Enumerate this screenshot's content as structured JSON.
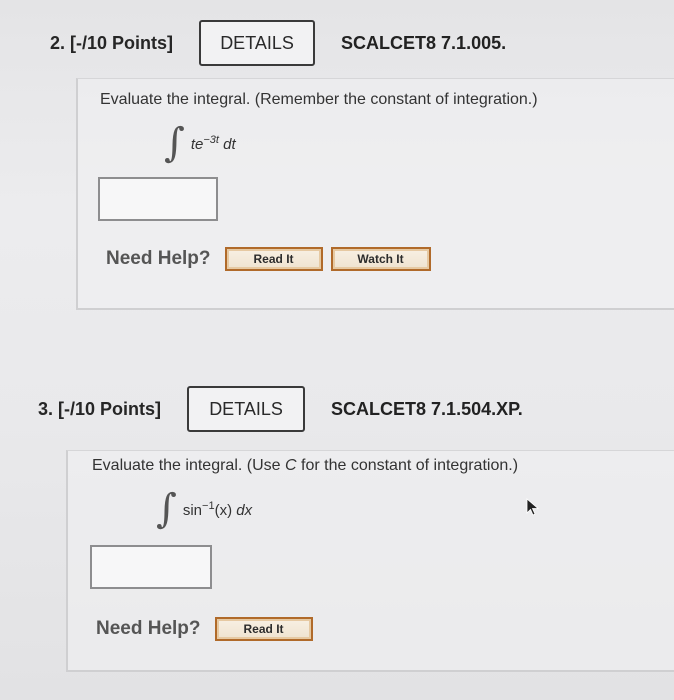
{
  "q2": {
    "number": "2. [-/10 Points]",
    "details_label": "DETAILS",
    "code": "SCALCET8 7.1.005.",
    "prompt": "Evaluate the integral. (Remember the constant of integration.)",
    "integrand_base": "te",
    "integrand_exp": "−3t",
    "differential": "dt",
    "answer_value": "",
    "need_help": "Need Help?",
    "read_it": "Read It",
    "watch_it": "Watch It"
  },
  "q3": {
    "number": "3. [-/10 Points]",
    "details_label": "DETAILS",
    "code": "SCALCET8 7.1.504.XP.",
    "prompt_pre": "Evaluate the integral. (Use ",
    "prompt_var": "C",
    "prompt_post": " for the constant of integration.)",
    "func": "sin",
    "func_exp": "−1",
    "func_arg": "(x)",
    "differential": "dx",
    "answer_value": "",
    "need_help": "Need Help?",
    "read_it": "Read It"
  },
  "colors": {
    "help_button_border": "#b06a2a",
    "details_border": "#3a3a3a"
  }
}
